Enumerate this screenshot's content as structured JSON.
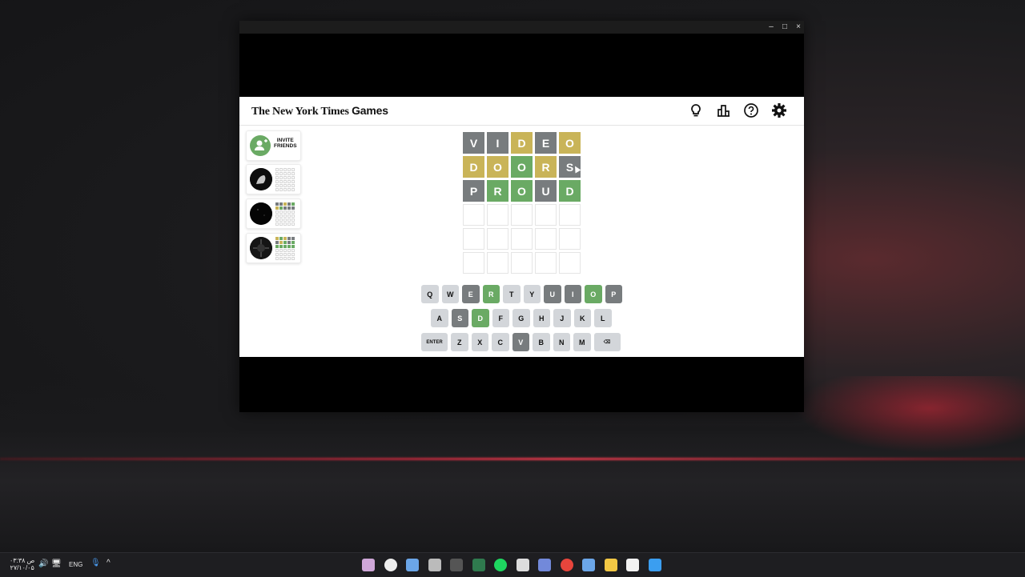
{
  "window": {
    "minimize_label": "–",
    "maximize_label": "□",
    "close_label": "×"
  },
  "header": {
    "logo_main": "The New York Times",
    "logo_games": "Games",
    "icons": [
      "hint-bulb-icon",
      "stats-icon",
      "help-icon",
      "settings-gear-icon"
    ]
  },
  "sidebar": {
    "invite_line1": "INVITE",
    "invite_line2": "FRIENDS"
  },
  "board": {
    "rows": [
      [
        {
          "l": "V",
          "s": "absent"
        },
        {
          "l": "I",
          "s": "absent"
        },
        {
          "l": "D",
          "s": "present"
        },
        {
          "l": "E",
          "s": "absent"
        },
        {
          "l": "O",
          "s": "present"
        }
      ],
      [
        {
          "l": "D",
          "s": "present"
        },
        {
          "l": "O",
          "s": "present"
        },
        {
          "l": "O",
          "s": "correct"
        },
        {
          "l": "R",
          "s": "present"
        },
        {
          "l": "S",
          "s": "absent"
        }
      ],
      [
        {
          "l": "P",
          "s": "absent"
        },
        {
          "l": "R",
          "s": "correct"
        },
        {
          "l": "O",
          "s": "correct"
        },
        {
          "l": "U",
          "s": "absent"
        },
        {
          "l": "D",
          "s": "correct"
        }
      ],
      [
        {
          "l": "",
          "s": "empty"
        },
        {
          "l": "",
          "s": "empty"
        },
        {
          "l": "",
          "s": "empty"
        },
        {
          "l": "",
          "s": "empty"
        },
        {
          "l": "",
          "s": "empty"
        }
      ],
      [
        {
          "l": "",
          "s": "empty"
        },
        {
          "l": "",
          "s": "empty"
        },
        {
          "l": "",
          "s": "empty"
        },
        {
          "l": "",
          "s": "empty"
        },
        {
          "l": "",
          "s": "empty"
        }
      ],
      [
        {
          "l": "",
          "s": "empty"
        },
        {
          "l": "",
          "s": "empty"
        },
        {
          "l": "",
          "s": "empty"
        },
        {
          "l": "",
          "s": "empty"
        },
        {
          "l": "",
          "s": "empty"
        }
      ]
    ]
  },
  "keyboard": {
    "row1": [
      {
        "k": "Q",
        "s": ""
      },
      {
        "k": "W",
        "s": ""
      },
      {
        "k": "E",
        "s": "absent"
      },
      {
        "k": "R",
        "s": "correct"
      },
      {
        "k": "T",
        "s": ""
      },
      {
        "k": "Y",
        "s": ""
      },
      {
        "k": "U",
        "s": "absent"
      },
      {
        "k": "I",
        "s": "absent"
      },
      {
        "k": "O",
        "s": "correct"
      },
      {
        "k": "P",
        "s": "absent"
      }
    ],
    "row2": [
      {
        "k": "A",
        "s": ""
      },
      {
        "k": "S",
        "s": "absent"
      },
      {
        "k": "D",
        "s": "correct"
      },
      {
        "k": "F",
        "s": ""
      },
      {
        "k": "G",
        "s": ""
      },
      {
        "k": "H",
        "s": ""
      },
      {
        "k": "J",
        "s": ""
      },
      {
        "k": "K",
        "s": ""
      },
      {
        "k": "L",
        "s": ""
      }
    ],
    "row3": [
      {
        "k": "ENTER",
        "s": "",
        "wide": true
      },
      {
        "k": "Z",
        "s": ""
      },
      {
        "k": "X",
        "s": ""
      },
      {
        "k": "C",
        "s": ""
      },
      {
        "k": "V",
        "s": "absent"
      },
      {
        "k": "B",
        "s": ""
      },
      {
        "k": "N",
        "s": ""
      },
      {
        "k": "M",
        "s": ""
      },
      {
        "k": "⌫",
        "s": "",
        "wide": true
      }
    ]
  },
  "taskbar": {
    "time": "۰۳:۳۸ ص",
    "date": "۲۷/۱۰/۰۵",
    "language": "ENG",
    "apps": [
      "app-icon",
      "obs-icon",
      "steam-icon",
      "app-icon",
      "terminal-icon",
      "excel-icon",
      "spotify-icon",
      "app-icon",
      "discord-icon",
      "chrome-icon",
      "steam-icon",
      "file-explorer-icon",
      "notepad-icon",
      "windows-icon"
    ]
  },
  "colors": {
    "correct": "#6aaa64",
    "present": "#c9b458",
    "absent": "#787c7e",
    "key_default": "#d3d6da"
  }
}
